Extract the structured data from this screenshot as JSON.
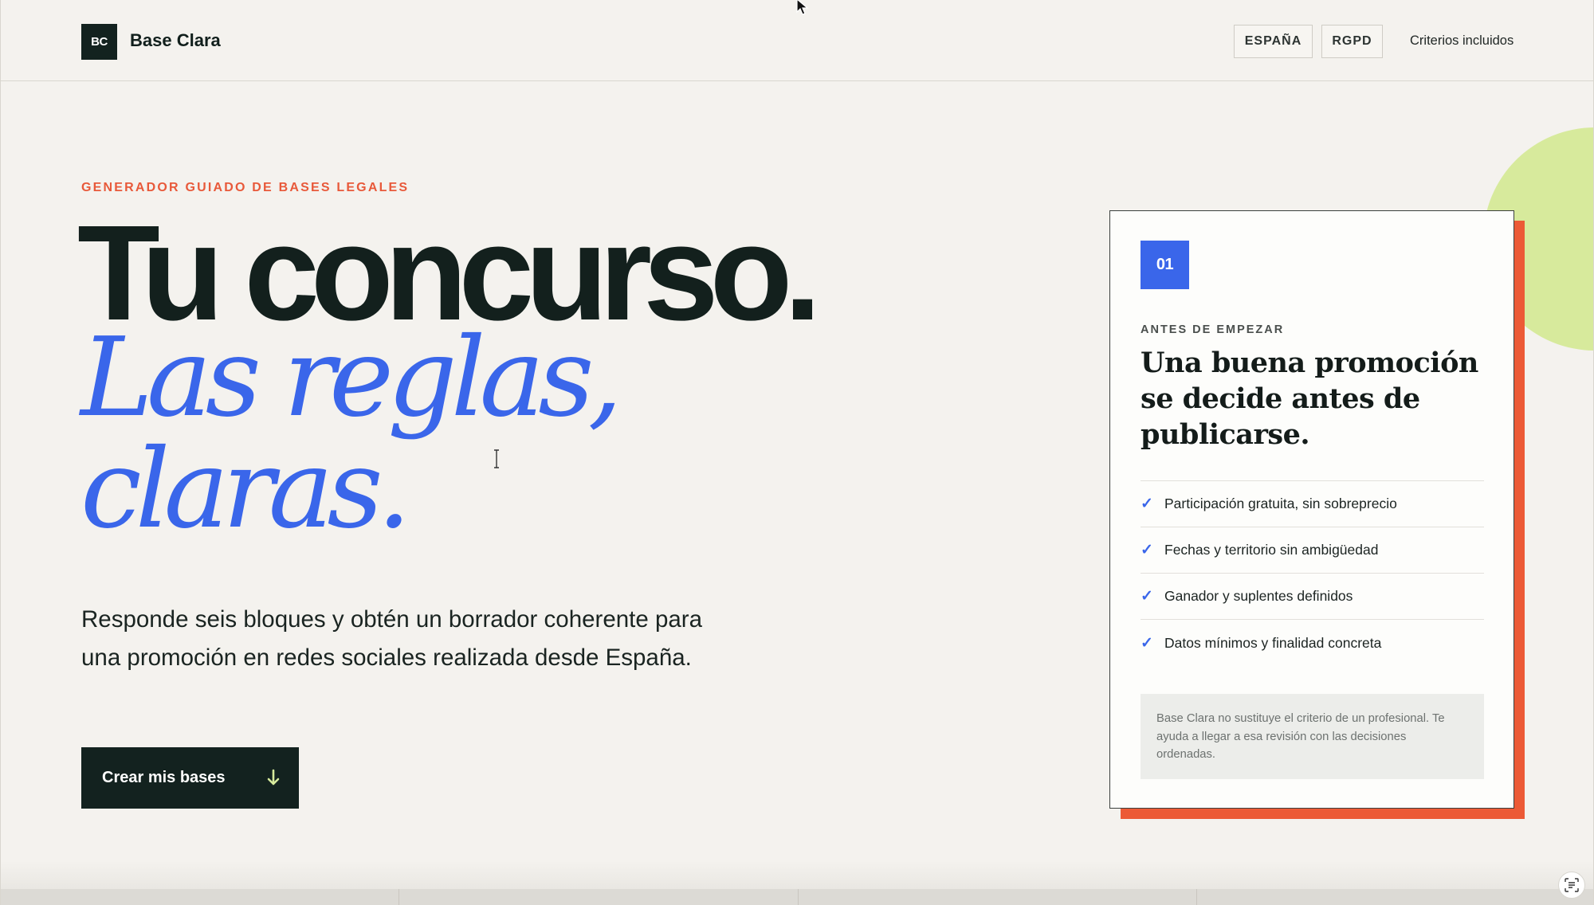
{
  "header": {
    "logo_text": "BC",
    "brand_name": "Base Clara",
    "pill_country": "ESPAÑA",
    "pill_rgpd": "RGPD",
    "nav_link": "Criterios incluidos"
  },
  "hero": {
    "eyebrow": "GENERADOR GUIADO DE BASES LEGALES",
    "headline_line1": "Tu concurso.",
    "headline_line2": "Las reglas,",
    "headline_line3": "claras.",
    "lead": "Responde seis bloques y obtén un borrador coherente para una promoción en redes sociales realizada desde España.",
    "cta_label": "Crear mis bases",
    "cta_icon": "arrow-down-icon"
  },
  "card": {
    "step": "01",
    "eyebrow": "ANTES DE EMPEZAR",
    "title": "Una buena promoción se decide antes de publicarse.",
    "checks": [
      "Participación gratuita, sin sobreprecio",
      "Fechas y territorio sin ambigüedad",
      "Ganador y suplentes definidos",
      "Datos mínimos y finalidad concreta"
    ],
    "note": "Base Clara no sustituye el criterio de un profesional. Te ayuda a llegar a esa revisión con las decisiones ordenadas."
  },
  "colors": {
    "background": "#f4f2ee",
    "dark": "#13221f",
    "accent_blue": "#3a66ea",
    "accent_orange": "#e8593a",
    "accent_lime": "#d7ea9c"
  }
}
